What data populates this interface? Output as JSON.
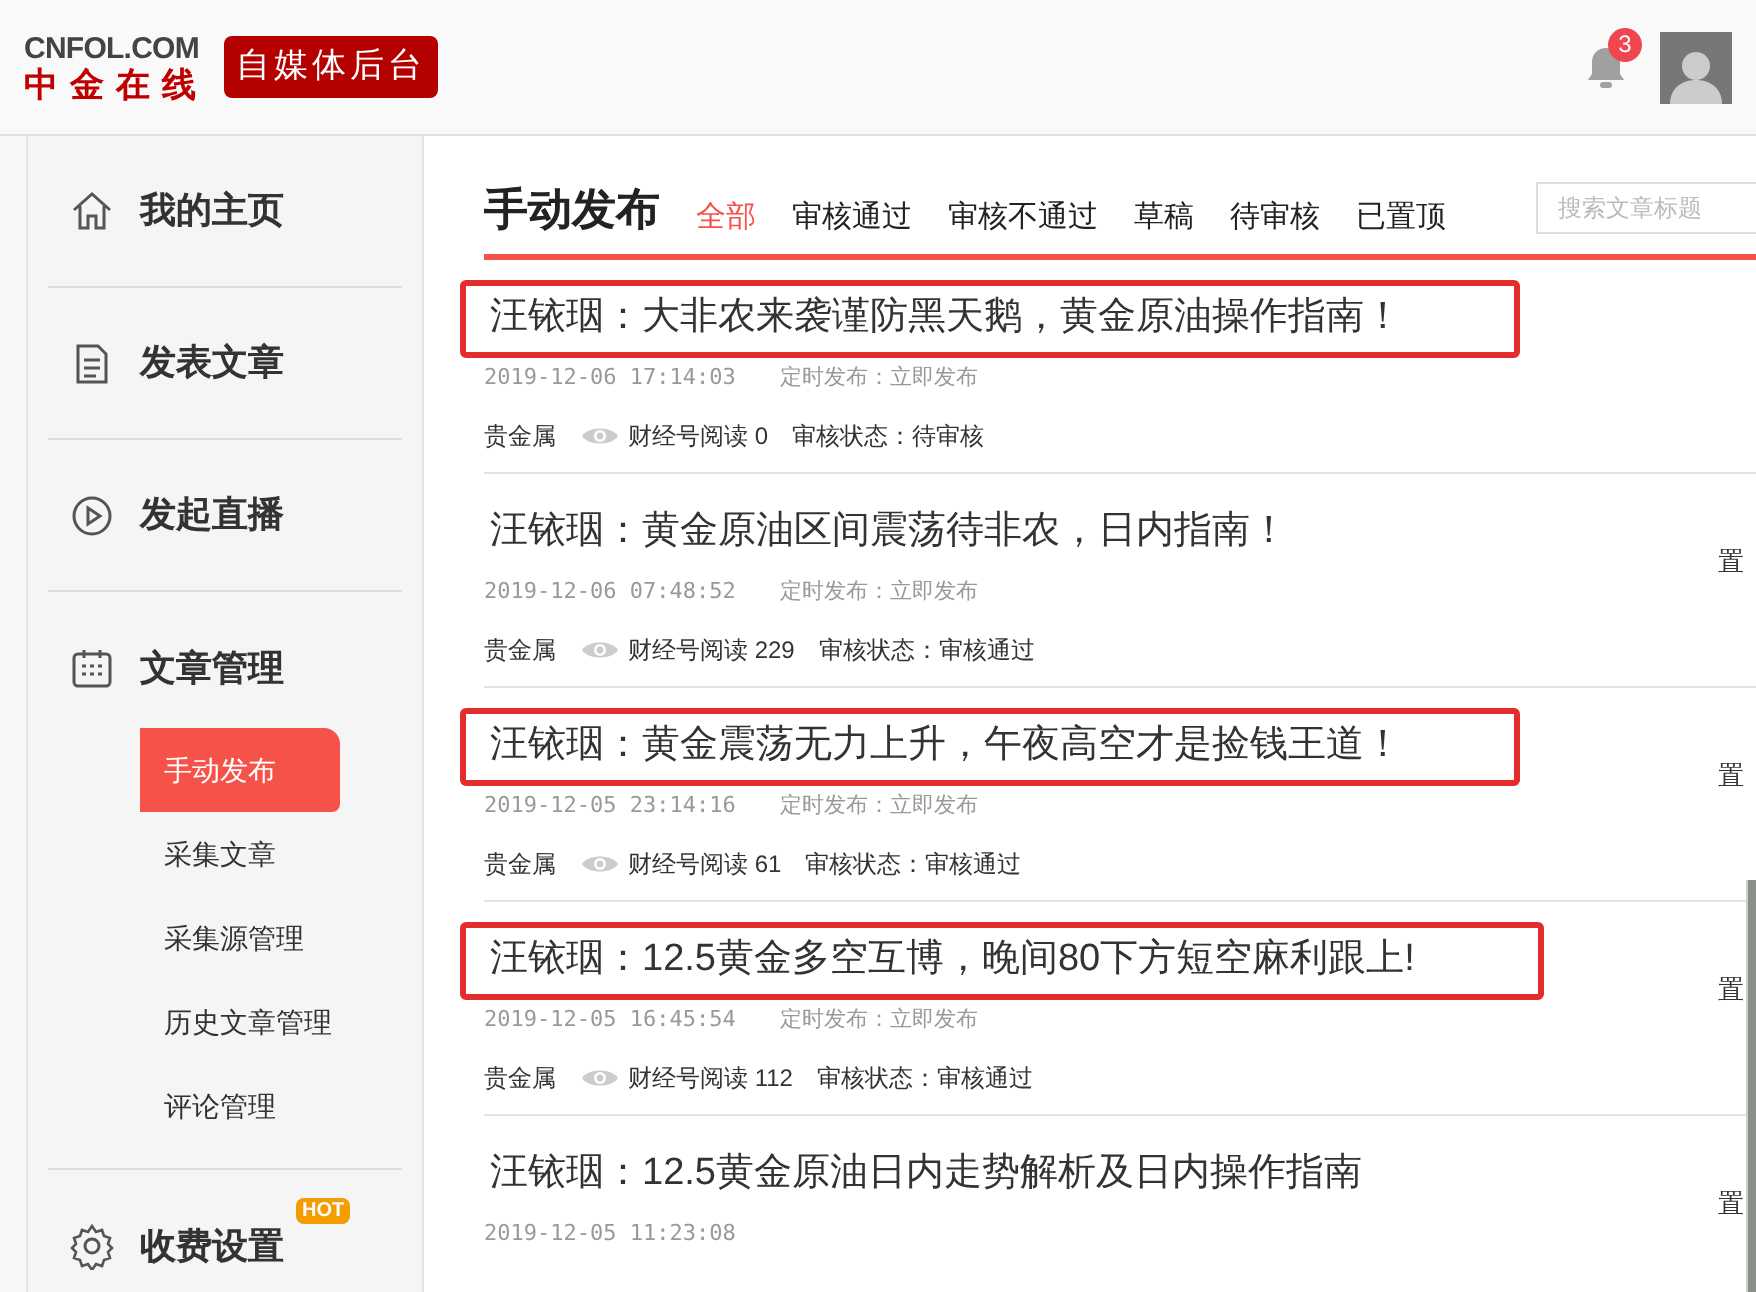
{
  "header": {
    "logo_top": "CNFOL.COM",
    "logo_bottom": "中金在线",
    "badge": "自媒体后台",
    "notifications": "3"
  },
  "sidebar": {
    "items": [
      {
        "label": "我的主页"
      },
      {
        "label": "发表文章"
      },
      {
        "label": "发起直播"
      },
      {
        "label": "文章管理",
        "children": [
          {
            "label": "手动发布",
            "selected": true
          },
          {
            "label": "采集文章",
            "selected": false
          },
          {
            "label": "采集源管理",
            "selected": false
          },
          {
            "label": "历史文章管理",
            "selected": false
          },
          {
            "label": "评论管理",
            "selected": false
          }
        ]
      },
      {
        "label": "收费设置",
        "hot": "HOT"
      }
    ]
  },
  "main": {
    "title": "手动发布",
    "tabs": [
      {
        "label": "全部",
        "selected": true
      },
      {
        "label": "审核通过",
        "selected": false
      },
      {
        "label": "审核不通过",
        "selected": false
      },
      {
        "label": "草稿",
        "selected": false
      },
      {
        "label": "待审核",
        "selected": false
      },
      {
        "label": "已置顶",
        "selected": false
      }
    ],
    "search": {
      "placeholder": "搜索文章标题"
    },
    "articles": [
      {
        "title": "汪铱珚：大非农来袭谨防黑天鹅，黄金原油操作指南！",
        "highlighted": true,
        "time": "2019-12-06 17:14:03",
        "schedule": "定时发布：立即发布",
        "category": "贵金属",
        "reads": "财经号阅读 0",
        "status": "审核状态：待审核"
      },
      {
        "title": "汪铱珚：黄金原油区间震荡待非农，日内指南！",
        "highlighted": false,
        "time": "2019-12-06 07:48:52",
        "schedule": "定时发布：立即发布",
        "category": "贵金属",
        "reads": "财经号阅读 229",
        "status": "审核状态：审核通过",
        "action": "置"
      },
      {
        "title": "汪铱珚：黄金震荡无力上升，午夜高空才是捡钱王道！",
        "highlighted": true,
        "time": "2019-12-05 23:14:16",
        "schedule": "定时发布：立即发布",
        "category": "贵金属",
        "reads": "财经号阅读 61",
        "status": "审核状态：审核通过",
        "action": "置"
      },
      {
        "title": "汪铱珚：12.5黄金多空互博，晚间80下方短空麻利跟上!",
        "highlighted": true,
        "time": "2019-12-05 16:45:54",
        "schedule": "定时发布：立即发布",
        "category": "贵金属",
        "reads": "财经号阅读 112",
        "status": "审核状态：审核通过",
        "action": "置"
      },
      {
        "title": "汪铱珚：12.5黄金原油日内走势解析及日内操作指南",
        "highlighted": false,
        "time": "2019-12-05 11:23:08",
        "action": "置"
      }
    ]
  }
}
